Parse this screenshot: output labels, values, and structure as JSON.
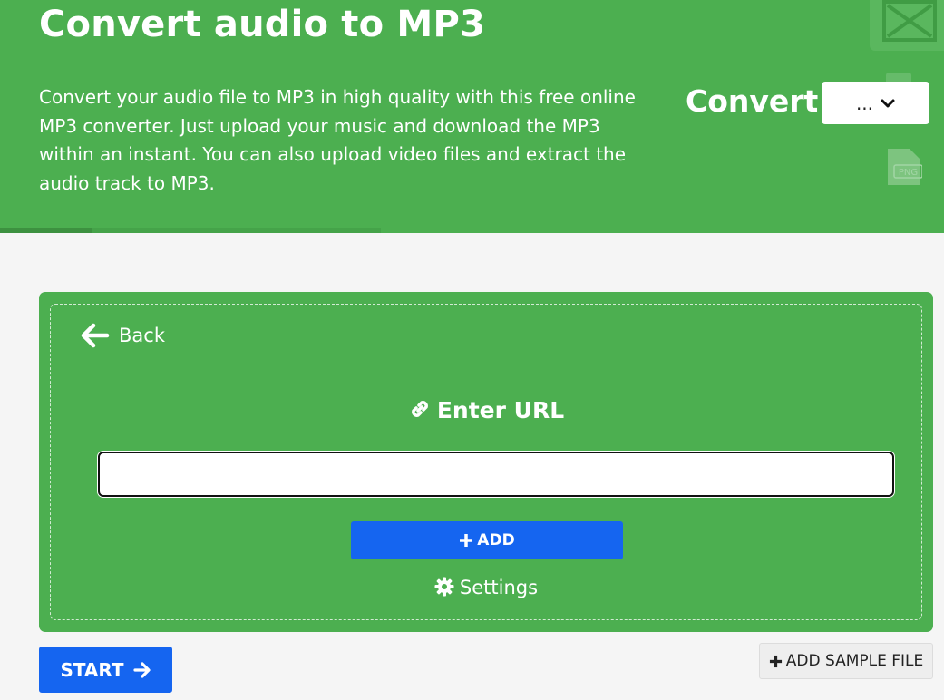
{
  "hero": {
    "title": "Convert audio to MP3",
    "description": "Convert your audio file to MP3 in high quality with this free online MP3 converter. Just upload your music and download the MP3 within an instant. You can also upload video files and extract the audio track to MP3.",
    "convert_label": "Convert",
    "convert_select_value": "...",
    "deco_file_label": "PNG"
  },
  "panel": {
    "back_label": "Back",
    "enter_url_label": "Enter URL",
    "url_input_value": "",
    "add_label": "ADD",
    "settings_label": "Settings"
  },
  "actions": {
    "start_label": "START",
    "add_sample_label": "ADD SAMPLE FILE"
  },
  "colors": {
    "brand_green": "#4caf50",
    "primary_blue": "#1565f0",
    "background": "#f5f5f5"
  },
  "icons": {
    "back": "arrow-left-icon",
    "link": "link-icon",
    "plus": "plus-icon",
    "gear": "gear-icon",
    "arrow_right": "arrow-right-icon",
    "chevron": "chevron-down-icon"
  }
}
